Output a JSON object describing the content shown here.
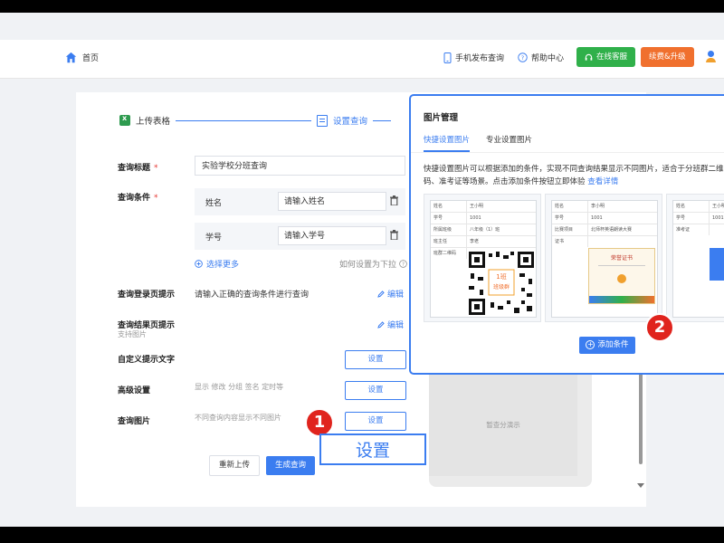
{
  "header": {
    "home": "首页",
    "mobile": "手机发布查询",
    "help": "帮助中心",
    "service": "在线客服",
    "upgrade": "续费&升级"
  },
  "steps": {
    "step1": "上传表格",
    "step2": "设置查询"
  },
  "form": {
    "title_label": "查询标题",
    "title_value": "实验学校分班查询",
    "cond_label": "查询条件",
    "conditions": [
      {
        "name": "姓名",
        "placeholder": "请输入姓名"
      },
      {
        "name": "学号",
        "placeholder": "请输入学号"
      }
    ],
    "more": "选择更多",
    "dropdown_hint": "如何设置为下拉",
    "login_label": "查询登录页提示",
    "login_value": "请输入正确的查询条件进行查询",
    "edit": "编辑",
    "result_label": "查询结果页提示",
    "result_sub": "支持图片",
    "custom_label": "自定义提示文字",
    "advanced_label": "高级设置",
    "advanced_hint": "显示 修改 分组 签名 定时等",
    "image_label": "查询图片",
    "image_hint": "不同查询内容显示不同图片",
    "setup": "设置",
    "reupload": "重新上传",
    "generate": "生成查询"
  },
  "preview": {
    "note": "暂查分演示"
  },
  "modal": {
    "title": "图片管理",
    "tab_quick": "快捷设置图片",
    "tab_pro": "专业设置图片",
    "desc": "快捷设置图片可以根据添加的条件，实现不同查询结果显示不同图片，适合于分班群二维码、准考证等场景。点击添加条件按钮立即体验",
    "detail_link": "查看详情",
    "card1": [
      [
        "姓名",
        "王小明"
      ],
      [
        "学号",
        "1001"
      ],
      [
        "所属班级",
        "八年级（1）班"
      ],
      [
        "班主任",
        "李老"
      ],
      [
        "班群二维码",
        ""
      ]
    ],
    "qr_text1": "1班",
    "qr_text2": "班级群",
    "card2": [
      [
        "姓名",
        "李小明"
      ],
      [
        "学号",
        "1001"
      ],
      [
        "比赛项目",
        "北师杯英语朗读大赛"
      ],
      [
        "证书",
        ""
      ]
    ],
    "cert_title": "荣誉证书",
    "card3": [
      [
        "姓名",
        "王小明"
      ],
      [
        "学号",
        "1001"
      ],
      [
        "准考证",
        ""
      ]
    ],
    "add": "添加条件"
  },
  "callouts": {
    "one": "1",
    "two": "2",
    "big_setup": "设置"
  },
  "colors": {
    "primary": "#3b7df0",
    "green": "#30b04a",
    "orange": "#f0702e",
    "badge": "#e0241d"
  }
}
